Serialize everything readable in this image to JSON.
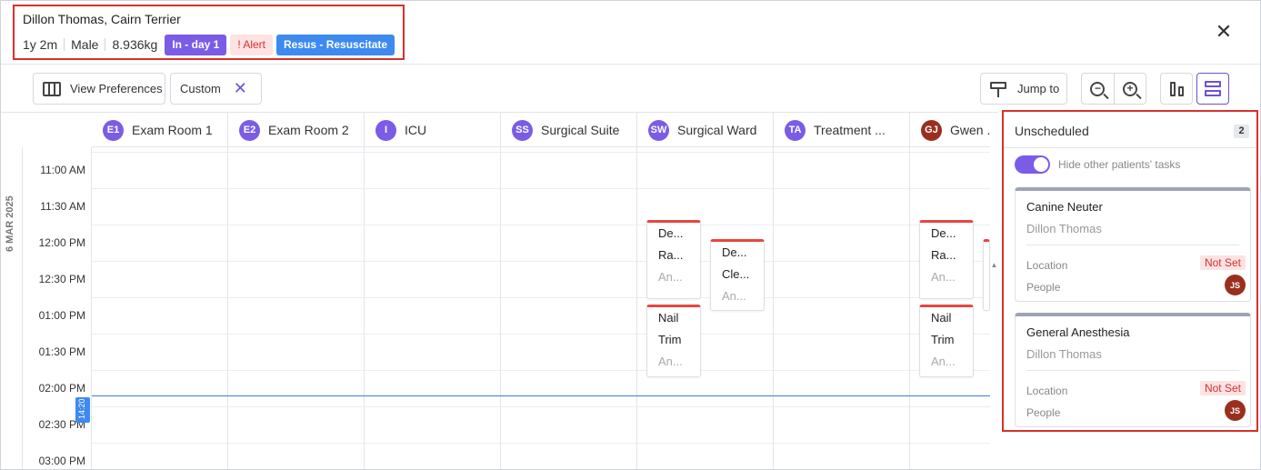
{
  "patient": {
    "name": "Dillon Thomas, Cairn Terrier",
    "age": "1y 2m",
    "sex": "Male",
    "weight": "8.936kg",
    "badges": {
      "stay": "In - day 1",
      "alert": "! Alert",
      "resus": "Resus - Resuscitate"
    }
  },
  "toolbar": {
    "view_preferences": "View Preferences",
    "custom": "Custom",
    "custom_clear": "✕",
    "jump_to": "Jump to"
  },
  "close_symbol": "✕",
  "calendar": {
    "date": "6 MAR 2025",
    "now_time": "14:20",
    "columns": [
      {
        "initials": "E1",
        "name": "Exam Room 1"
      },
      {
        "initials": "E2",
        "name": "Exam Room 2"
      },
      {
        "initials": "I",
        "name": "ICU"
      },
      {
        "initials": "SS",
        "name": "Surgical Suite"
      },
      {
        "initials": "SW",
        "name": "Surgical Ward"
      },
      {
        "initials": "TA",
        "name": "Treatment ..."
      },
      {
        "initials": "GJ",
        "name": "Gwen ..."
      }
    ],
    "times": [
      "11:00 AM",
      "11:30 AM",
      "12:00 PM",
      "12:30 PM",
      "01:00 PM",
      "01:30 PM",
      "02:00 PM",
      "02:30 PM",
      "03:00 PM"
    ],
    "tasks": {
      "sw1": [
        "De...",
        "Ra...",
        "An..."
      ],
      "sw2": [
        "De...",
        "Cle...",
        "An..."
      ],
      "sw3": [
        "Nail",
        "Trim",
        "An..."
      ],
      "gj1": [
        "De...",
        "Ra...",
        "An..."
      ],
      "gj2": [
        "Nail",
        "Trim",
        "An..."
      ]
    }
  },
  "unscheduled": {
    "title": "Unscheduled",
    "count": "2",
    "toggle_label": "Hide other patients' tasks",
    "cards": [
      {
        "title": "Canine Neuter",
        "patient": "Dillon Thomas",
        "location_label": "Location",
        "location_value": "Not Set",
        "people_label": "People",
        "people_initials": "JS"
      },
      {
        "title": "General Anesthesia",
        "patient": "Dillon Thomas",
        "location_label": "Location",
        "location_value": "Not Set",
        "people_label": "People",
        "people_initials": "JS"
      }
    ]
  },
  "colors": {
    "accent": "#7b5ce6",
    "alert": "#d9302c",
    "resus": "#3d8af0",
    "now_line": "#3d7bd9"
  }
}
